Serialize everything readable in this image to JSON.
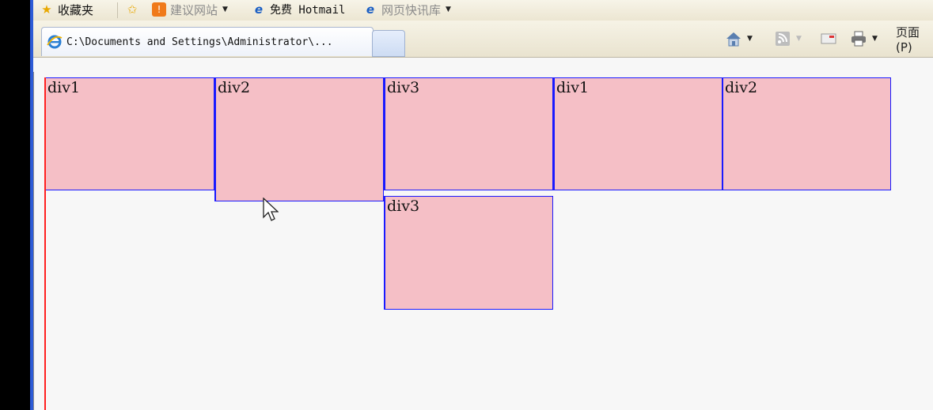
{
  "favorites_bar": {
    "favorites_label": "收藏夹",
    "items": [
      {
        "label": "建议网站",
        "icon": "suggested-sites-icon",
        "dropdown": true
      },
      {
        "label": "免费 Hotmail",
        "icon": "ie-page-icon",
        "dropdown": false
      },
      {
        "label": "网页快讯库",
        "icon": "ie-page-icon",
        "dropdown": true
      }
    ]
  },
  "tabs": [
    {
      "title": "C:\\Documents and Settings\\Administrator\\...",
      "icon": "ie-icon",
      "active": true
    }
  ],
  "command_bar": {
    "page_menu_label": "页面(P)"
  },
  "page": {
    "boxes": [
      {
        "label": "div1"
      },
      {
        "label": "div2"
      },
      {
        "label": "div3"
      },
      {
        "label": "div1"
      },
      {
        "label": "div2"
      },
      {
        "label": "div3"
      }
    ]
  },
  "colors": {
    "box_fill": "#f5bfc6",
    "box_border_blue": "#1a1aff",
    "box_border_red": "#ff2020",
    "float_line": "#ff2020",
    "page_background": "#f7f7f7"
  }
}
